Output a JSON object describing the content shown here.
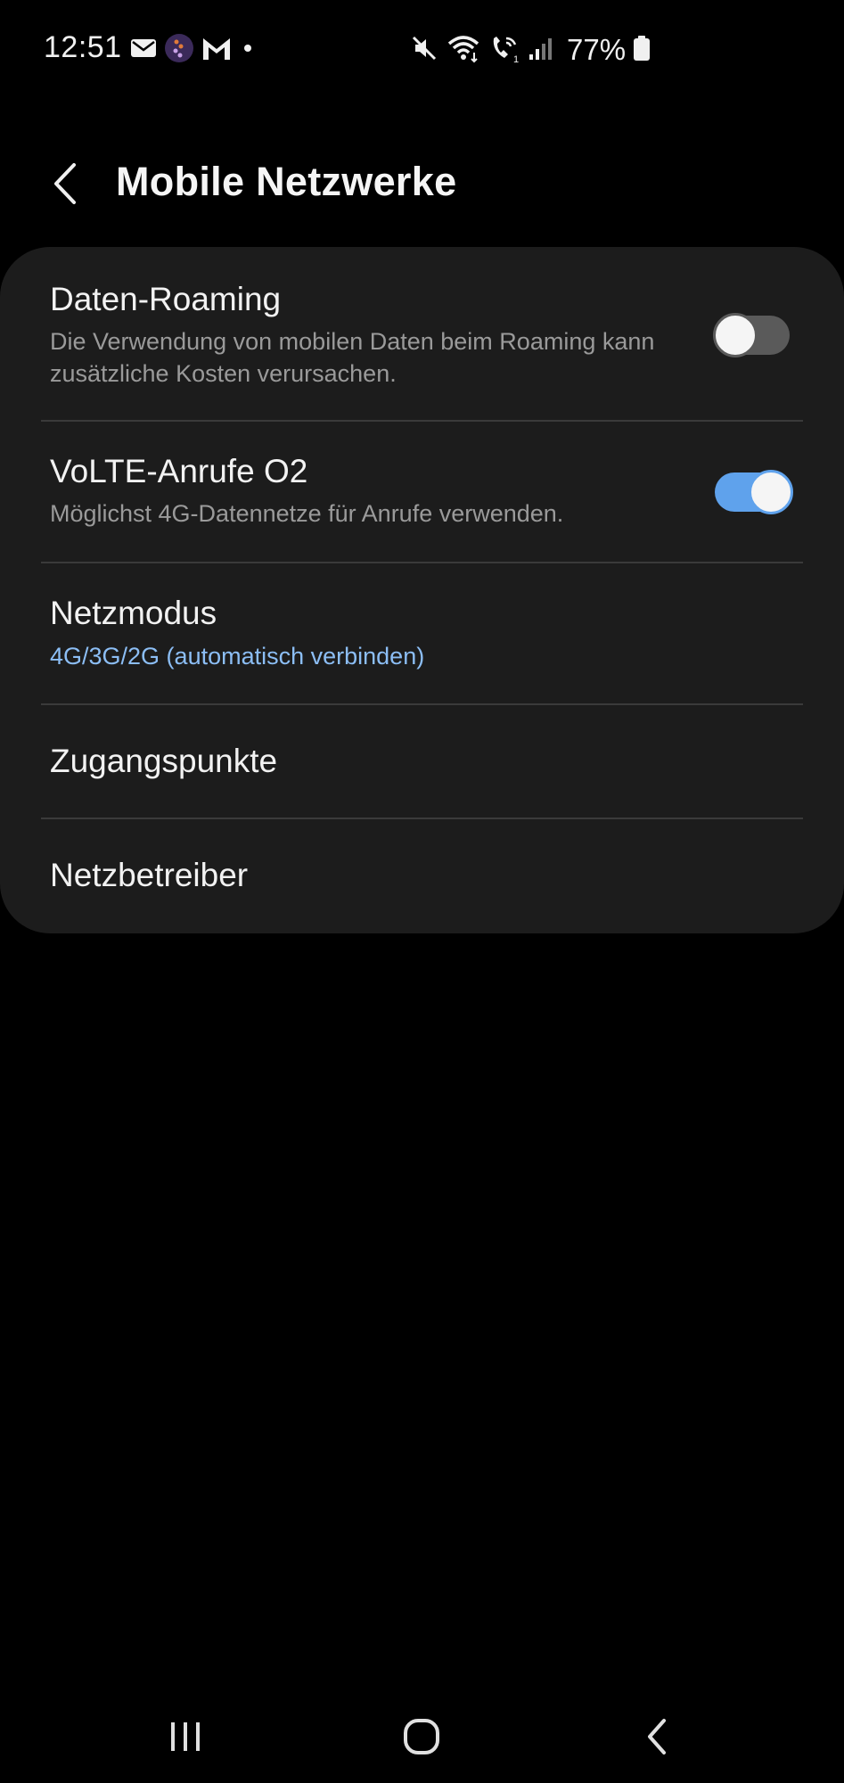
{
  "status_bar": {
    "time": "12:51",
    "battery": "77%",
    "left_icons": [
      "mail-icon",
      "app-icon",
      "gmail-icon",
      "dot-icon"
    ],
    "right_icons": [
      "mute-icon",
      "wifi-icon",
      "wifi-call-icon",
      "signal-icon",
      "battery-icon"
    ]
  },
  "header": {
    "title": "Mobile Netzwerke",
    "back_icon": "chevron-left-icon"
  },
  "settings": {
    "data_roaming": {
      "title": "Daten-Roaming",
      "subtitle": "Die Verwendung von mobilen Daten beim Roaming kann zusätzliche Kosten verursachen.",
      "enabled": false
    },
    "volte": {
      "title": "VoLTE-Anrufe O2",
      "subtitle": "Möglichst 4G-Datennetze für Anrufe verwenden.",
      "enabled": true
    },
    "network_mode": {
      "title": "Netzmodus",
      "value": "4G/3G/2G (automatisch verbinden)"
    },
    "access_points": {
      "title": "Zugangspunkte"
    },
    "operators": {
      "title": "Netzbetreiber"
    }
  },
  "colors": {
    "background": "#000000",
    "card": "#1c1c1c",
    "accent": "#8cbef5",
    "toggle_on": "#5fa2ec",
    "toggle_off": "#5a5a5a"
  },
  "nav_bar": {
    "items": [
      "recent-apps-icon",
      "home-icon",
      "back-icon"
    ]
  }
}
